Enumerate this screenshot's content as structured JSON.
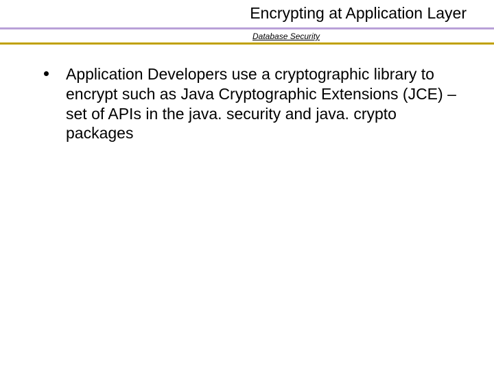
{
  "header": {
    "title": "Encrypting at Application Layer",
    "subtitle": "Database Security"
  },
  "content": {
    "bullets": [
      "Application Developers use a cryptographic library to encrypt such as Java Cryptographic Extensions (JCE) – set of APIs in the java. security and java. crypto packages"
    ]
  }
}
